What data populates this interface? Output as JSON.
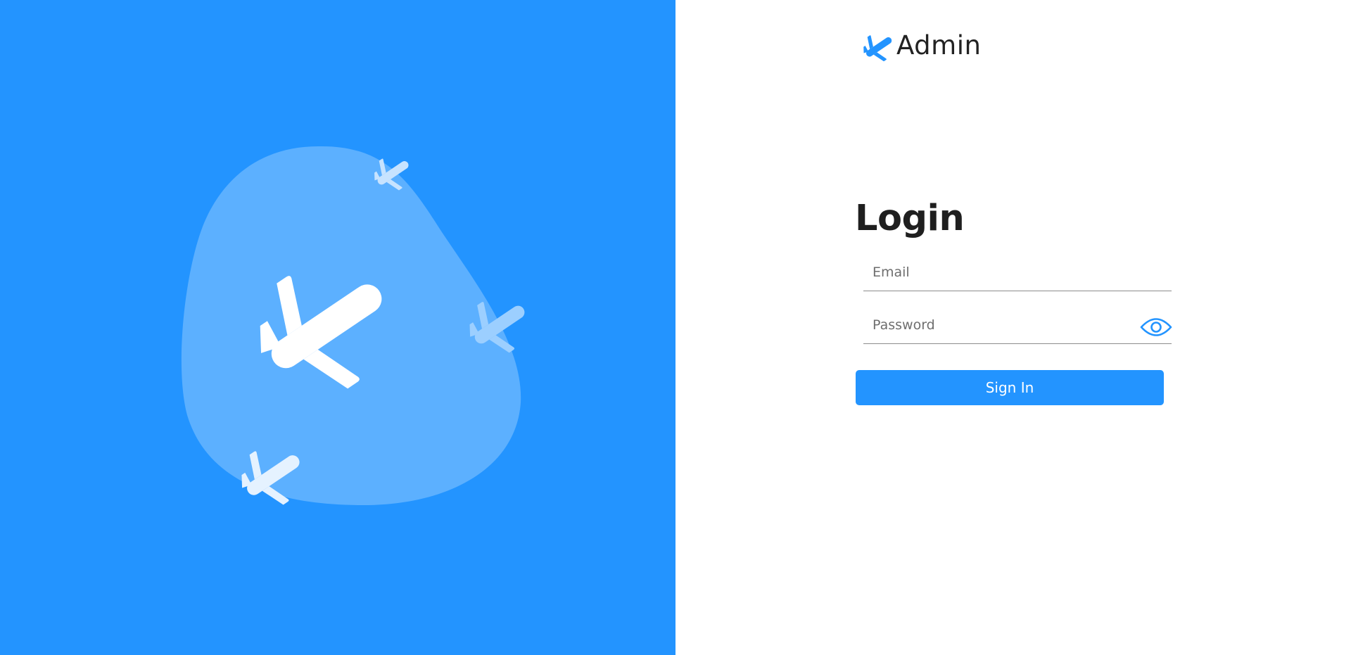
{
  "colors": {
    "accent": "#2394ff",
    "blob": "#5cb0ff",
    "plane_main": "#ffffff",
    "text_dark": "#1f1f1f"
  },
  "brand": {
    "icon": "airplane-icon",
    "name": "Admin"
  },
  "login": {
    "title": "Login",
    "email": {
      "placeholder": "Email",
      "value": ""
    },
    "password": {
      "placeholder": "Password",
      "value": "",
      "toggle_icon": "eye-icon"
    },
    "submit_label": "Sign In"
  },
  "illustration": {
    "icons": [
      "airplane-icon",
      "airplane-icon",
      "airplane-icon",
      "airplane-icon"
    ]
  }
}
